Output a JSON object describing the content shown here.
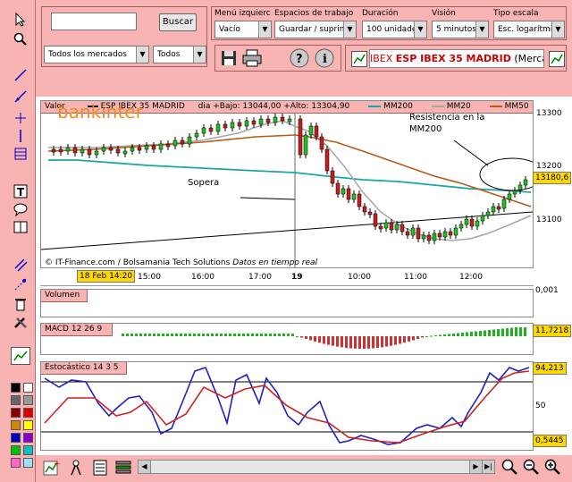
{
  "search": {
    "value": "",
    "button": "Buscar",
    "market": "Todos los mercados",
    "filter": "Todos"
  },
  "menu": {
    "label": "Menú izquierc",
    "value": "Vacío"
  },
  "workspace": {
    "label": "Espacios de trabajo",
    "value": "Guardar / suprimir"
  },
  "duration": {
    "label": "Duración",
    "value": "100 unidades"
  },
  "vision": {
    "label": "Visión",
    "value": "5 minutos"
  },
  "scale": {
    "label": "Tipo escala",
    "value": "Esc. logarítmica"
  },
  "instrument": {
    "prefix": "IBEX",
    "name": "ESP IBEX 35 MADRID",
    "market": "(Merca"
  },
  "main": {
    "value_label": "Valor",
    "series": "ESP IBEX 35 MADRID",
    "stats": "dia +Bajo: 13044,00 +Alto: 13304,90",
    "mm200": "MM200",
    "mm20": "MM20",
    "mm50": "MM50",
    "logo": "bankinter",
    "credit": "© IT-Finance.com / Bolsamania Tech Solutions",
    "realtime": "Datos en tiempo real",
    "ann_resist": "Resistencia en la MM200",
    "ann_support": "Sopera",
    "price_tag": "13180,6",
    "y_labels": [
      "13300",
      "13200",
      "13100"
    ],
    "x_labels": [
      "15:00",
      "16:00",
      "17:00",
      "19",
      "10:00",
      "11:00",
      "12:00"
    ],
    "date_tag": "18 Feb 14:20"
  },
  "volume": {
    "label": "Volumen",
    "tag": "0,001"
  },
  "macd": {
    "label": "MACD 12 26 9",
    "tag": "11,7218"
  },
  "stoch": {
    "label": "Estocástico 14 3 5",
    "tag_top": "94,213",
    "tag_bottom": "0,5445",
    "mid": "50"
  },
  "colors": {
    "mm200": "#1aa6a6",
    "mm20": "#a6a6a6",
    "mm50": "#b85a1a",
    "panel": "#f8b3b3",
    "k": "#2020c0",
    "d": "#d02020"
  }
}
